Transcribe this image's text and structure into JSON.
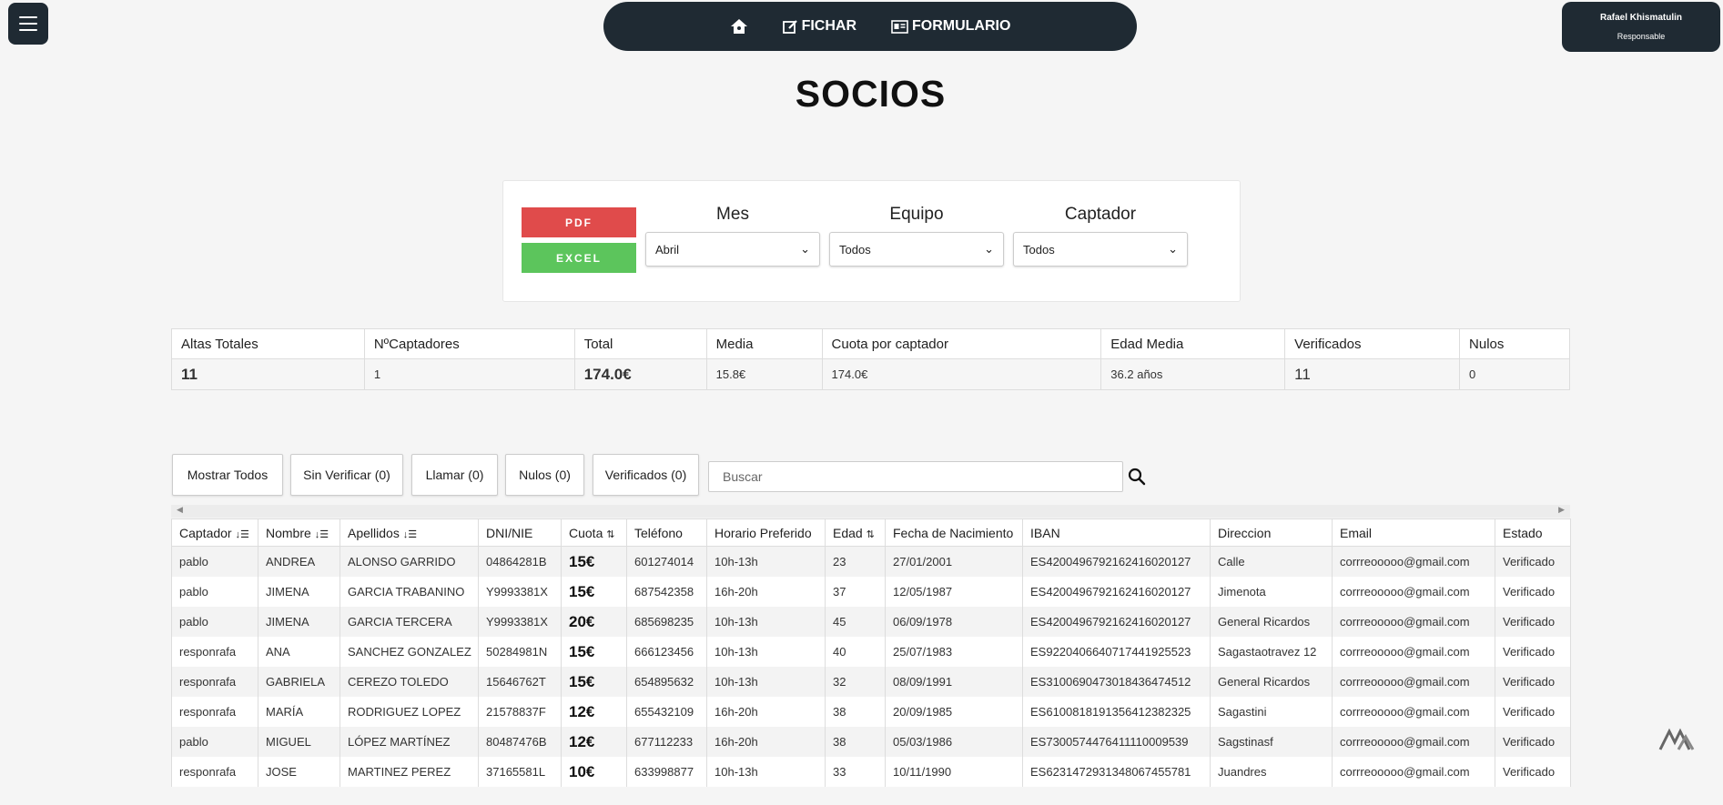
{
  "nav": {
    "home_icon": "home-icon",
    "fichar_label": "FICHAR",
    "formulario_label": "FORMULARIO"
  },
  "user": {
    "name": "Rafael Khismatulin",
    "role": "Responsable"
  },
  "page_title": "SOCIOS",
  "actions": {
    "pdf": "PDF",
    "excel": "EXCEL"
  },
  "filters": {
    "mes": {
      "label": "Mes",
      "value": "Abril"
    },
    "equipo": {
      "label": "Equipo",
      "value": "Todos"
    },
    "captador": {
      "label": "Captador",
      "value": "Todos"
    }
  },
  "stats": {
    "headers": [
      "Altas Totales",
      "NºCaptadores",
      "Total",
      "Media",
      "Cuota por captador",
      "Edad Media",
      "Verificados",
      "Nulos"
    ],
    "values": [
      "11",
      "1",
      "174.0€",
      "15.8€",
      "174.0€",
      "36.2 años",
      "11",
      "0"
    ]
  },
  "filter_buttons": [
    "Mostrar Todos",
    "Sin Verificar (0)",
    "Llamar (0)",
    "Nulos (0)",
    "Verificados (0)"
  ],
  "search": {
    "placeholder": "Buscar"
  },
  "table": {
    "headers": [
      "Captador",
      "Nombre",
      "Apellidos",
      "DNI/NIE",
      "Cuota",
      "Teléfono",
      "Horario Preferido",
      "Edad",
      "Fecha de Nacimiento",
      "IBAN",
      "Direccion",
      "Email",
      "Estado"
    ],
    "rows": [
      [
        "pablo",
        "ANDREA",
        "ALONSO GARRIDO",
        "04864281B",
        "15€",
        "601274014",
        "10h-13h",
        "23",
        "27/01/2001",
        "ES4200496792162416020127",
        "Calle",
        "corrreooooo@gmail.com",
        "Verificado"
      ],
      [
        "pablo",
        "JIMENA",
        "GARCIA TRABANINO",
        "Y9993381X",
        "15€",
        "687542358",
        "16h-20h",
        "37",
        "12/05/1987",
        "ES4200496792162416020127",
        "Jimenota",
        "corrreooooo@gmail.com",
        "Verificado"
      ],
      [
        "pablo",
        "JIMENA",
        "GARCIA TERCERA",
        "Y9993381X",
        "20€",
        "685698235",
        "10h-13h",
        "45",
        "06/09/1978",
        "ES4200496792162416020127",
        "General Ricardos",
        "corrreooooo@gmail.com",
        "Verificado"
      ],
      [
        "responrafa",
        "ANA",
        "SANCHEZ GONZALEZ",
        "50284981N",
        "15€",
        "666123456",
        "10h-13h",
        "40",
        "25/07/1983",
        "ES9220406640717441925523",
        "Sagastaotravez 12",
        "corrreooooo@gmail.com",
        "Verificado"
      ],
      [
        "responrafa",
        "GABRIELA",
        "CEREZO TOLEDO",
        "15646762T",
        "15€",
        "654895632",
        "10h-13h",
        "32",
        "08/09/1991",
        "ES3100690473018436474512",
        "General Ricardos",
        "corrreooooo@gmail.com",
        "Verificado"
      ],
      [
        "responrafa",
        "MARÍA",
        "RODRIGUEZ LOPEZ",
        "21578837F",
        "12€",
        "655432109",
        "16h-20h",
        "38",
        "20/09/1985",
        "ES6100818191356412382325",
        "Sagastini",
        "corrreooooo@gmail.com",
        "Verificado"
      ],
      [
        "pablo",
        "MIGUEL",
        "LÓPEZ MARTÍNEZ",
        "80487476B",
        "12€",
        "677112233",
        "16h-20h",
        "38",
        "05/03/1986",
        "ES7300574476411110009539",
        "Sagstinasf",
        "corrreooooo@gmail.com",
        "Verificado"
      ],
      [
        "responrafa",
        "JOSE",
        "MARTINEZ PEREZ",
        "37165581L",
        "10€",
        "633998877",
        "10h-13h",
        "33",
        "10/11/1990",
        "ES6231472931348067455781",
        "Juandres",
        "corrreooooo@gmail.com",
        "Verificado"
      ]
    ]
  }
}
